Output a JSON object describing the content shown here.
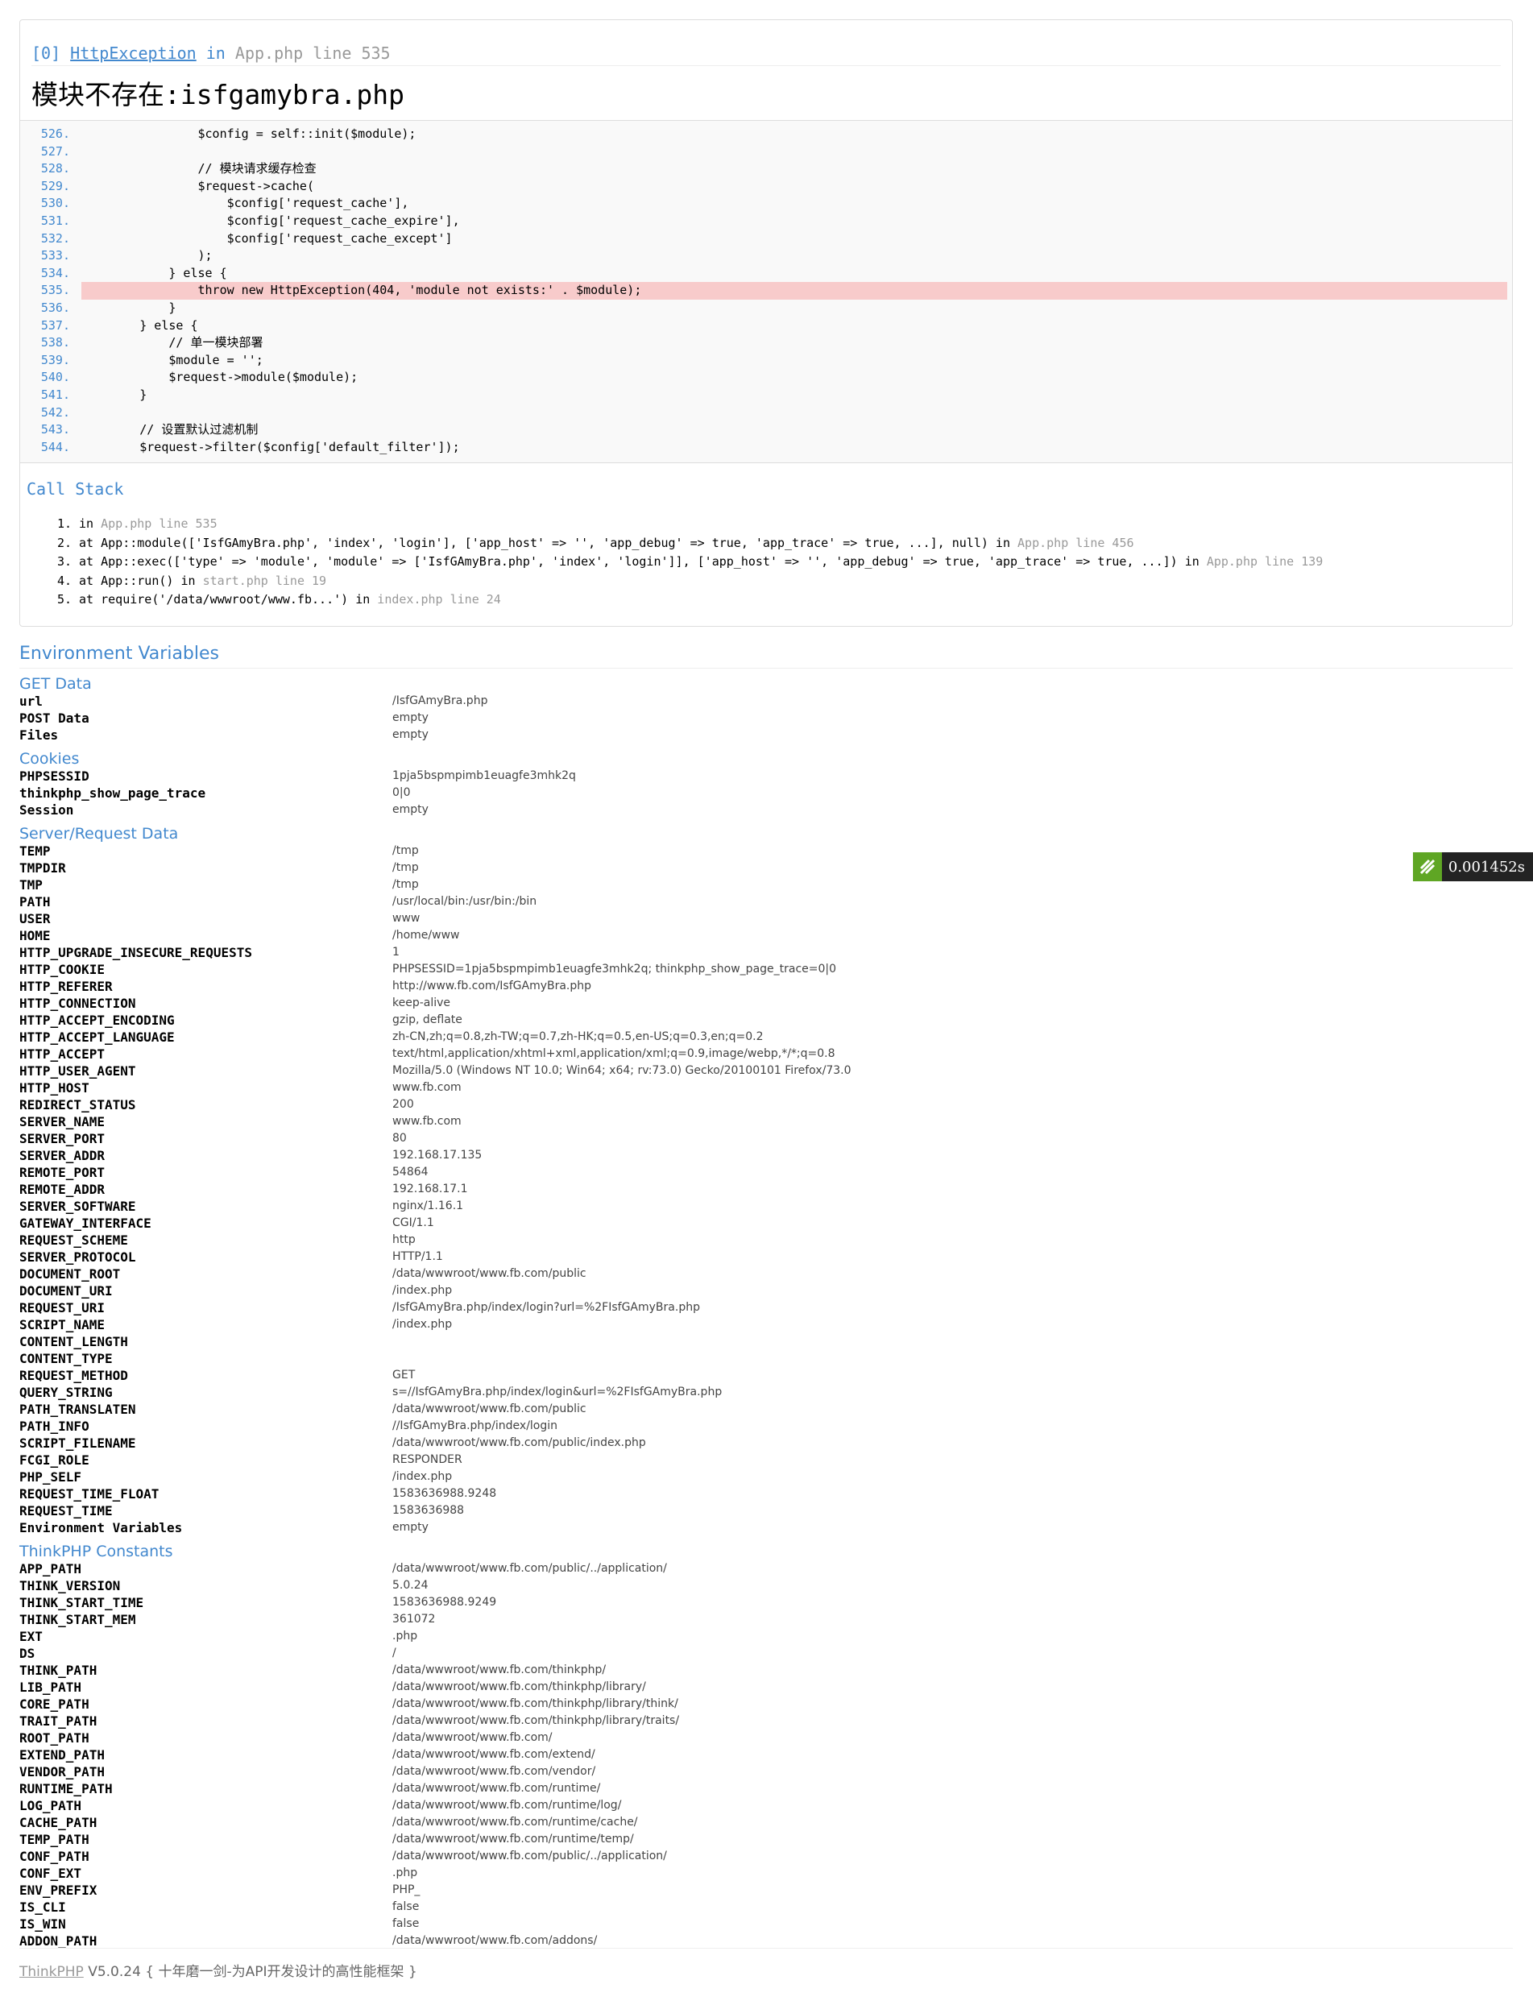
{
  "exception": {
    "index": "[0]",
    "class": "HttpException",
    "in_word": "in",
    "file": "App.php line 535",
    "message": "模块不存在:isfgamybra.php"
  },
  "source_lines": [
    {
      "no": "526.",
      "code": "                $config = self::init($module);"
    },
    {
      "no": "527.",
      "code": ""
    },
    {
      "no": "528.",
      "code": "                // 模块请求缓存检查"
    },
    {
      "no": "529.",
      "code": "                $request->cache("
    },
    {
      "no": "530.",
      "code": "                    $config['request_cache'],"
    },
    {
      "no": "531.",
      "code": "                    $config['request_cache_expire'],"
    },
    {
      "no": "532.",
      "code": "                    $config['request_cache_except']"
    },
    {
      "no": "533.",
      "code": "                );"
    },
    {
      "no": "534.",
      "code": "            } else {"
    },
    {
      "no": "535.",
      "code": "                throw new HttpException(404, 'module not exists:' . $module);"
    },
    {
      "no": "536.",
      "code": "            }"
    },
    {
      "no": "537.",
      "code": "        } else {"
    },
    {
      "no": "538.",
      "code": "            // 单一模块部署"
    },
    {
      "no": "539.",
      "code": "            $module = '';"
    },
    {
      "no": "540.",
      "code": "            $request->module($module);"
    },
    {
      "no": "541.",
      "code": "        }"
    },
    {
      "no": "542.",
      "code": ""
    },
    {
      "no": "543.",
      "code": "        // 设置默认过滤机制"
    },
    {
      "no": "544.",
      "code": "        $request->filter($config['default_filter']);"
    }
  ],
  "highlight_line": "535.",
  "call_stack": {
    "title": "Call Stack",
    "items": [
      {
        "n": "1.",
        "pre": "in ",
        "call": "",
        "loc": "App.php line 535"
      },
      {
        "n": "2.",
        "pre": "at ",
        "call": "App::module(['IsfGAmyBra.php', 'index', 'login'], ['app_host' => '', 'app_debug' => true, 'app_trace' => true, ...], null) in ",
        "loc": "App.php line 456"
      },
      {
        "n": "3.",
        "pre": "at ",
        "call": "App::exec(['type' => 'module', 'module' => ['IsfGAmyBra.php', 'index', 'login']], ['app_host' => '', 'app_debug' => true, 'app_trace' => true, ...]) in ",
        "loc": "App.php line 139"
      },
      {
        "n": "4.",
        "pre": "at ",
        "call": "App::run() in ",
        "loc": "start.php line 19"
      },
      {
        "n": "5.",
        "pre": "at ",
        "call": "require('/data/wwwroot/www.fb...') in ",
        "loc": "index.php line 24"
      }
    ]
  },
  "env": {
    "title": "Environment Variables",
    "sections": [
      {
        "title": "GET Data",
        "rows": [
          [
            "url",
            "/IsfGAmyBra.php"
          ]
        ]
      },
      {
        "title": "",
        "rows": [
          [
            "POST Data",
            "empty"
          ],
          [
            "Files",
            "empty"
          ]
        ]
      },
      {
        "title": "Cookies",
        "rows": [
          [
            "PHPSESSID",
            "1pja5bspmpimb1euagfe3mhk2q"
          ],
          [
            "thinkphp_show_page_trace",
            "0|0"
          ]
        ]
      },
      {
        "title": "",
        "rows": [
          [
            "Session",
            "empty"
          ]
        ]
      },
      {
        "title": "Server/Request Data",
        "rows": [
          [
            "TEMP",
            "/tmp"
          ],
          [
            "TMPDIR",
            "/tmp"
          ],
          [
            "TMP",
            "/tmp"
          ],
          [
            "PATH",
            "/usr/local/bin:/usr/bin:/bin"
          ],
          [
            "USER",
            "www"
          ],
          [
            "HOME",
            "/home/www"
          ],
          [
            "HTTP_UPGRADE_INSECURE_REQUESTS",
            "1"
          ],
          [
            "HTTP_COOKIE",
            "PHPSESSID=1pja5bspmpimb1euagfe3mhk2q; thinkphp_show_page_trace=0|0"
          ],
          [
            "HTTP_REFERER",
            "http://www.fb.com/IsfGAmyBra.php"
          ],
          [
            "HTTP_CONNECTION",
            "keep-alive"
          ],
          [
            "HTTP_ACCEPT_ENCODING",
            "gzip, deflate"
          ],
          [
            "HTTP_ACCEPT_LANGUAGE",
            "zh-CN,zh;q=0.8,zh-TW;q=0.7,zh-HK;q=0.5,en-US;q=0.3,en;q=0.2"
          ],
          [
            "HTTP_ACCEPT",
            "text/html,application/xhtml+xml,application/xml;q=0.9,image/webp,*/*;q=0.8"
          ],
          [
            "HTTP_USER_AGENT",
            "Mozilla/5.0 (Windows NT 10.0; Win64; x64; rv:73.0) Gecko/20100101 Firefox/73.0"
          ],
          [
            "HTTP_HOST",
            "www.fb.com"
          ],
          [
            "REDIRECT_STATUS",
            "200"
          ],
          [
            "SERVER_NAME",
            "www.fb.com"
          ],
          [
            "SERVER_PORT",
            "80"
          ],
          [
            "SERVER_ADDR",
            "192.168.17.135"
          ],
          [
            "REMOTE_PORT",
            "54864"
          ],
          [
            "REMOTE_ADDR",
            "192.168.17.1"
          ],
          [
            "SERVER_SOFTWARE",
            "nginx/1.16.1"
          ],
          [
            "GATEWAY_INTERFACE",
            "CGI/1.1"
          ],
          [
            "REQUEST_SCHEME",
            "http"
          ],
          [
            "SERVER_PROTOCOL",
            "HTTP/1.1"
          ],
          [
            "DOCUMENT_ROOT",
            "/data/wwwroot/www.fb.com/public"
          ],
          [
            "DOCUMENT_URI",
            "/index.php"
          ],
          [
            "REQUEST_URI",
            "/IsfGAmyBra.php/index/login?url=%2FIsfGAmyBra.php"
          ],
          [
            "SCRIPT_NAME",
            "/index.php"
          ],
          [
            "CONTENT_LENGTH",
            ""
          ],
          [
            "CONTENT_TYPE",
            ""
          ],
          [
            "REQUEST_METHOD",
            "GET"
          ],
          [
            "QUERY_STRING",
            "s=//IsfGAmyBra.php/index/login&url=%2FIsfGAmyBra.php"
          ],
          [
            "PATH_TRANSLATEN",
            "/data/wwwroot/www.fb.com/public"
          ],
          [
            "PATH_INFO",
            "//IsfGAmyBra.php/index/login"
          ],
          [
            "SCRIPT_FILENAME",
            "/data/wwwroot/www.fb.com/public/index.php"
          ],
          [
            "FCGI_ROLE",
            "RESPONDER"
          ],
          [
            "PHP_SELF",
            "/index.php"
          ],
          [
            "REQUEST_TIME_FLOAT",
            "1583636988.9248"
          ],
          [
            "REQUEST_TIME",
            "1583636988"
          ]
        ]
      },
      {
        "title": "",
        "rows": [
          [
            "Environment Variables",
            "empty"
          ]
        ]
      },
      {
        "title": "ThinkPHP Constants",
        "rows": [
          [
            "APP_PATH",
            "/data/wwwroot/www.fb.com/public/../application/"
          ],
          [
            "THINK_VERSION",
            "5.0.24"
          ],
          [
            "THINK_START_TIME",
            "1583636988.9249"
          ],
          [
            "THINK_START_MEM",
            "361072"
          ],
          [
            "EXT",
            ".php"
          ],
          [
            "DS",
            "/"
          ],
          [
            "THINK_PATH",
            "/data/wwwroot/www.fb.com/thinkphp/"
          ],
          [
            "LIB_PATH",
            "/data/wwwroot/www.fb.com/thinkphp/library/"
          ],
          [
            "CORE_PATH",
            "/data/wwwroot/www.fb.com/thinkphp/library/think/"
          ],
          [
            "TRAIT_PATH",
            "/data/wwwroot/www.fb.com/thinkphp/library/traits/"
          ],
          [
            "ROOT_PATH",
            "/data/wwwroot/www.fb.com/"
          ],
          [
            "EXTEND_PATH",
            "/data/wwwroot/www.fb.com/extend/"
          ],
          [
            "VENDOR_PATH",
            "/data/wwwroot/www.fb.com/vendor/"
          ],
          [
            "RUNTIME_PATH",
            "/data/wwwroot/www.fb.com/runtime/"
          ],
          [
            "LOG_PATH",
            "/data/wwwroot/www.fb.com/runtime/log/"
          ],
          [
            "CACHE_PATH",
            "/data/wwwroot/www.fb.com/runtime/cache/"
          ],
          [
            "TEMP_PATH",
            "/data/wwwroot/www.fb.com/runtime/temp/"
          ],
          [
            "CONF_PATH",
            "/data/wwwroot/www.fb.com/public/../application/"
          ],
          [
            "CONF_EXT",
            ".php"
          ],
          [
            "ENV_PREFIX",
            "PHP_"
          ],
          [
            "IS_CLI",
            "false"
          ],
          [
            "IS_WIN",
            "false"
          ],
          [
            "ADDON_PATH",
            "/data/wwwroot/www.fb.com/addons/"
          ]
        ]
      }
    ]
  },
  "footer": {
    "brand": "ThinkPHP",
    "text": " V5.0.24 { 十年磨一剑-为API开发设计的高性能框架 }"
  },
  "trace": {
    "time": "0.001452s"
  }
}
